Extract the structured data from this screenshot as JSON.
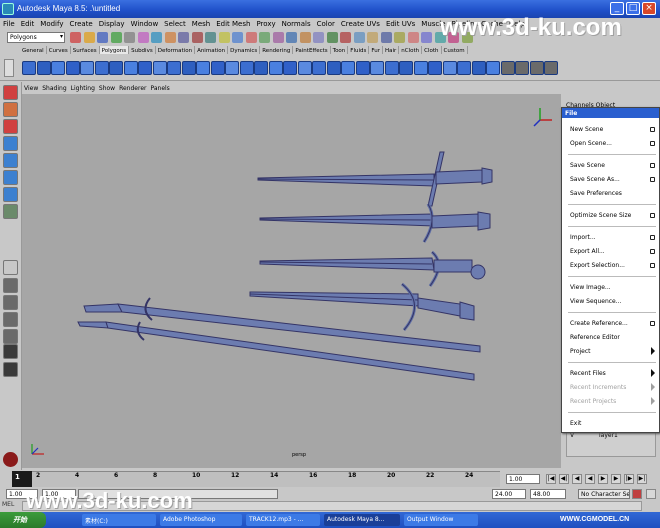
{
  "window": {
    "title": "Autodesk Maya 8.5: .\\untitled",
    "controls": [
      "minimize-icon",
      "maximize-icon",
      "close-icon"
    ]
  },
  "menubar": [
    "File",
    "Edit",
    "Modify",
    "Create",
    "Display",
    "Window",
    "Select",
    "Mesh",
    "Edit Mesh",
    "Proxy",
    "Normals",
    "Color",
    "Create UVs",
    "Edit UVs",
    "Muscle",
    "Pipeline Cache",
    "Help"
  ],
  "mode_selector": {
    "value": "Polygons"
  },
  "shelf_tabs": [
    "General",
    "Curves",
    "Surfaces",
    "Polygons",
    "Subdivs",
    "Deformation",
    "Animation",
    "Dynamics",
    "Rendering",
    "PaintEffects",
    "Toon",
    "Fluids",
    "Fur",
    "Hair",
    "nCloth",
    "Cloth",
    "Custom"
  ],
  "shelf_active_tab": "Polygons",
  "panel_menu": [
    "View",
    "Shading",
    "Lighting",
    "Show",
    "Renderer",
    "Panels"
  ],
  "viewport": {
    "camera_label": "persp",
    "background": "#a6a6a6",
    "wire_color": "#3a3a70",
    "mesh_color": "#6c7cb0"
  },
  "channel_box": {
    "header": "Channels Object",
    "layer_visible": "V",
    "layer_name": "layer1"
  },
  "file_menu": {
    "header": "File",
    "items": [
      {
        "label": "New Scene",
        "option_box": true,
        "submenu": false,
        "disabled": false
      },
      {
        "label": "Open Scene...",
        "option_box": true,
        "submenu": false,
        "disabled": false
      },
      {
        "label": "Save Scene",
        "option_box": true,
        "submenu": false,
        "disabled": false
      },
      {
        "label": "Save Scene As...",
        "option_box": true,
        "submenu": false,
        "disabled": false
      },
      {
        "label": "Save Preferences",
        "option_box": false,
        "submenu": false,
        "disabled": false
      },
      {
        "label": "Optimize Scene Size",
        "option_box": true,
        "submenu": false,
        "disabled": false
      },
      {
        "label": "Import...",
        "option_box": true,
        "submenu": false,
        "disabled": false
      },
      {
        "label": "Export All...",
        "option_box": true,
        "submenu": false,
        "disabled": false
      },
      {
        "label": "Export Selection...",
        "option_box": true,
        "submenu": false,
        "disabled": false
      },
      {
        "label": "View Image...",
        "option_box": false,
        "submenu": false,
        "disabled": false
      },
      {
        "label": "View Sequence...",
        "option_box": false,
        "submenu": false,
        "disabled": false
      },
      {
        "label": "Create Reference...",
        "option_box": true,
        "submenu": false,
        "disabled": false
      },
      {
        "label": "Reference Editor",
        "option_box": false,
        "submenu": false,
        "disabled": false
      },
      {
        "label": "Project",
        "option_box": false,
        "submenu": true,
        "disabled": false
      },
      {
        "label": "Recent Files",
        "option_box": false,
        "submenu": true,
        "disabled": false
      },
      {
        "label": "Recent Increments",
        "option_box": false,
        "submenu": true,
        "disabled": true
      },
      {
        "label": "Recent Projects",
        "option_box": false,
        "submenu": true,
        "disabled": true
      },
      {
        "label": "Exit",
        "option_box": false,
        "submenu": false,
        "disabled": false
      }
    ]
  },
  "timeline": {
    "current_frame": "1",
    "ticks": [
      "2",
      "4",
      "6",
      "8",
      "10",
      "12",
      "14",
      "16",
      "18",
      "20",
      "22",
      "24"
    ],
    "current_time_field": "1.00",
    "playback_buttons": [
      "go-to-start-icon",
      "step-back-key-icon",
      "step-back-icon",
      "play-back-icon",
      "play-forward-icon",
      "step-forward-icon",
      "step-forward-key-icon",
      "go-to-end-icon"
    ]
  },
  "range_slider": {
    "start_time": "1.00",
    "playback_start": "1.00",
    "playback_end": "24.00",
    "end_time": "48.00",
    "character_set": "No Character Set"
  },
  "command_line": {
    "label": "MEL"
  },
  "taskbar": {
    "start_label": "开始",
    "tasks": [
      "素材(C:)",
      "Adobe Photoshop",
      "TRACK12.mp3 - ...",
      "Autodesk Maya 8...",
      "Output Window"
    ],
    "active_task": "Autodesk Maya 8..."
  },
  "watermarks": [
    "www.3d-ku.com",
    "www.3d-ku.com",
    "WWW.CGMODEL.CN"
  ]
}
